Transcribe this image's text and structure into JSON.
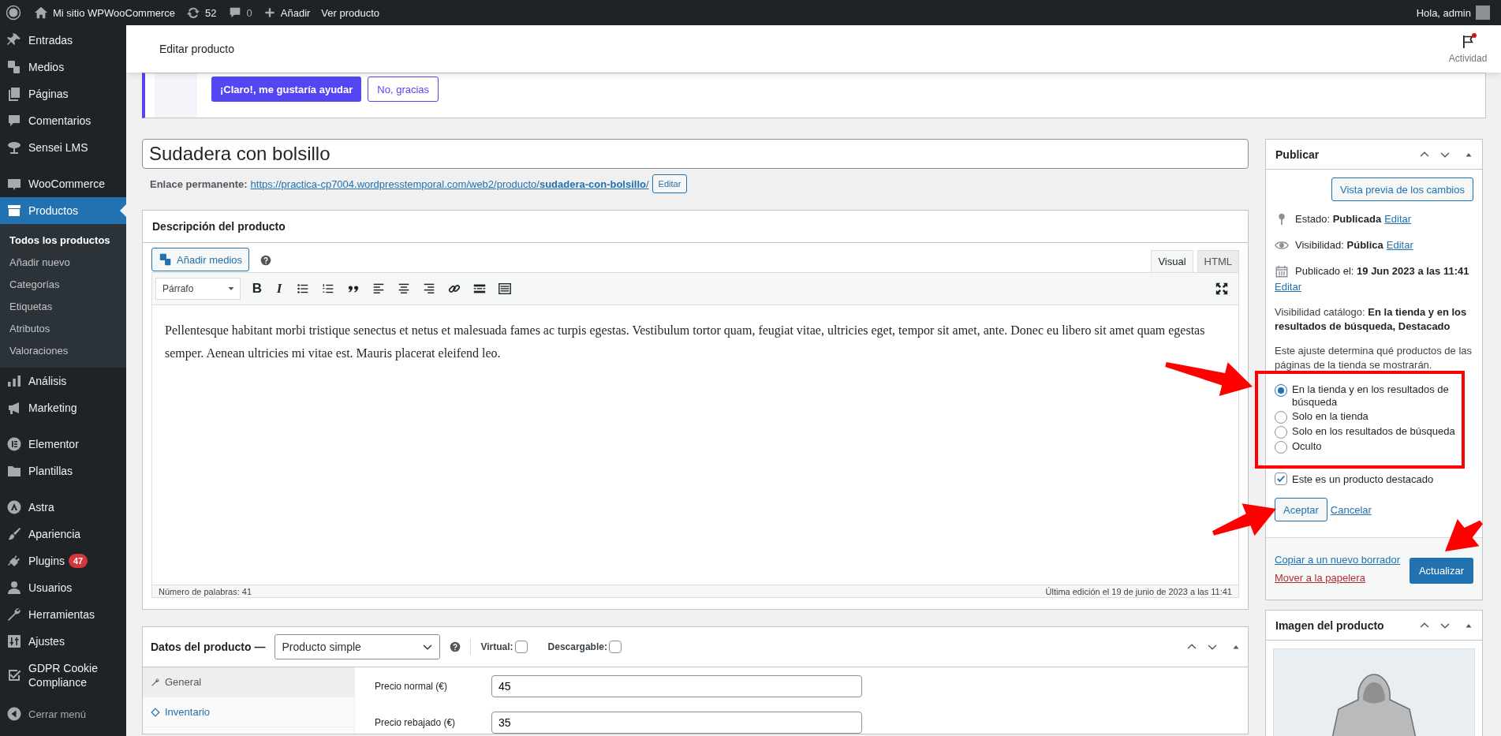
{
  "admin_bar": {
    "site": "Mi sitio WPWooCommerce",
    "updates": "52",
    "comments": "0",
    "add": "Añadir",
    "view": "Ver producto",
    "greeting": "Hola, admin"
  },
  "sidebar": {
    "groups": [
      {
        "items": [
          {
            "label": "Entradas",
            "selected": false
          },
          {
            "label": "Medios",
            "selected": false
          },
          {
            "label": "Páginas",
            "selected": false
          },
          {
            "label": "Comentarios",
            "selected": false
          },
          {
            "label": "Sensei LMS",
            "selected": false
          }
        ]
      },
      {
        "items": [
          {
            "label": "WooCommerce",
            "selected": false
          },
          {
            "label": "Productos",
            "selected": true,
            "children": [
              {
                "label": "Todos los productos",
                "selected": true
              },
              {
                "label": "Añadir nuevo",
                "selected": false
              },
              {
                "label": "Categorías",
                "selected": false
              },
              {
                "label": "Etiquetas",
                "selected": false
              },
              {
                "label": "Atributos",
                "selected": false
              },
              {
                "label": "Valoraciones",
                "selected": false
              }
            ]
          },
          {
            "label": "Análisis",
            "selected": false
          },
          {
            "label": "Marketing",
            "selected": false
          }
        ]
      },
      {
        "items": [
          {
            "label": "Elementor",
            "selected": false
          },
          {
            "label": "Plantillas",
            "selected": false
          }
        ]
      },
      {
        "items": [
          {
            "label": "Astra",
            "selected": false
          },
          {
            "label": "Apariencia",
            "selected": false
          },
          {
            "label": "Plugins",
            "selected": false,
            "badge": "47"
          },
          {
            "label": "Usuarios",
            "selected": false
          },
          {
            "label": "Herramientas",
            "selected": false
          },
          {
            "label": "Ajustes",
            "selected": false
          },
          {
            "label": "GDPR Cookie Compliance",
            "selected": false
          }
        ]
      }
    ],
    "collapse": "Cerrar menú"
  },
  "header": {
    "title": "Editar producto",
    "activity": "Actividad",
    "activity_unread": true
  },
  "notice": {
    "buttons": [
      {
        "label": "¡Claro!, me gustaría ayudar",
        "kind": "primary"
      },
      {
        "label": "No, gracias",
        "kind": "secondary"
      }
    ]
  },
  "post_title": "Sudadera con bolsillo",
  "permalink": {
    "label": "Enlace permanente:",
    "url": "https://practica-cp7004.wordpresstemporal.com/web2/producto/**sudadera-con-bolsillo**/",
    "button": "Editar"
  },
  "description": {
    "title": "Descripción del producto",
    "media_button": "Añadir medios",
    "tabs": [
      {
        "label": "Visual",
        "selected": true
      },
      {
        "label": "HTML",
        "selected": false
      }
    ],
    "format_select": "Párrafo",
    "toolbar": [
      {
        "kind": "bold",
        "glyph": "B"
      },
      {
        "kind": "italic",
        "glyph": "I"
      },
      {
        "kind": "bullet-list"
      },
      {
        "kind": "numbered-list"
      },
      {
        "kind": "quote"
      },
      {
        "kind": "align-left"
      },
      {
        "kind": "align-center"
      },
      {
        "kind": "align-right"
      },
      {
        "kind": "link"
      },
      {
        "kind": "read-more"
      },
      {
        "kind": "toolbar-toggle"
      },
      {
        "kind": "fullscreen"
      }
    ],
    "content": "Pellentesque habitant morbi tristique senectus et netus et malesuada fames ac turpis egestas. Vestibulum tortor quam, feugiat vitae, ultricies eget, tempor sit amet, ante. Donec eu libero sit amet quam egestas semper. Aenean ultricies mi vitae est. Mauris placerat eleifend leo.",
    "word_count": "Número de palabras: 41",
    "last_edit": "Última edición el 19 de junio de 2023 a las 11:41"
  },
  "product_data": {
    "title": "Datos del producto —",
    "type": "Producto simple",
    "options": [
      {
        "label": "Virtual:",
        "checked": false
      },
      {
        "label": "Descargable:",
        "checked": false
      }
    ],
    "tabs": [
      {
        "label": "General",
        "selected": true
      },
      {
        "label": "Inventario",
        "selected": false
      }
    ],
    "fields": [
      {
        "label": "Precio normal (€)",
        "value": "45"
      },
      {
        "label": "Precio rebajado (€)",
        "value": "35"
      }
    ]
  },
  "publish": {
    "title": "Publicar",
    "preview": "Vista previa de los cambios",
    "rows": [
      {
        "text": "Estado: **Publicada**",
        "link": "Editar"
      },
      {
        "text": "Visibilidad: **Pública**",
        "link": "Editar"
      },
      {
        "text": "Publicado el: **19 Jun 2023 a las 11:41**",
        "link": "Editar"
      }
    ],
    "catalog": "Visibilidad catálogo: **En la tienda y en los resultados de búsqueda, Destacado**",
    "help": "Este ajuste determina qué productos de las páginas de la tienda se mostrarán.",
    "options": [
      {
        "label": "En la tienda y en los resultados de búsqueda",
        "selected": true
      },
      {
        "label": "Solo en la tienda",
        "selected": false
      },
      {
        "label": "Solo en los resultados de búsqueda",
        "selected": false
      },
      {
        "label": "Oculto",
        "selected": false
      }
    ],
    "featured": {
      "label": "Este es un producto destacado",
      "checked": true
    },
    "accept": "Aceptar",
    "cancel": "Cancelar",
    "copy": "Copiar a un nuevo borrador",
    "trash": "Mover a la papelera",
    "update": "Actualizar"
  },
  "image_box": {
    "title": "Imagen del producto"
  }
}
